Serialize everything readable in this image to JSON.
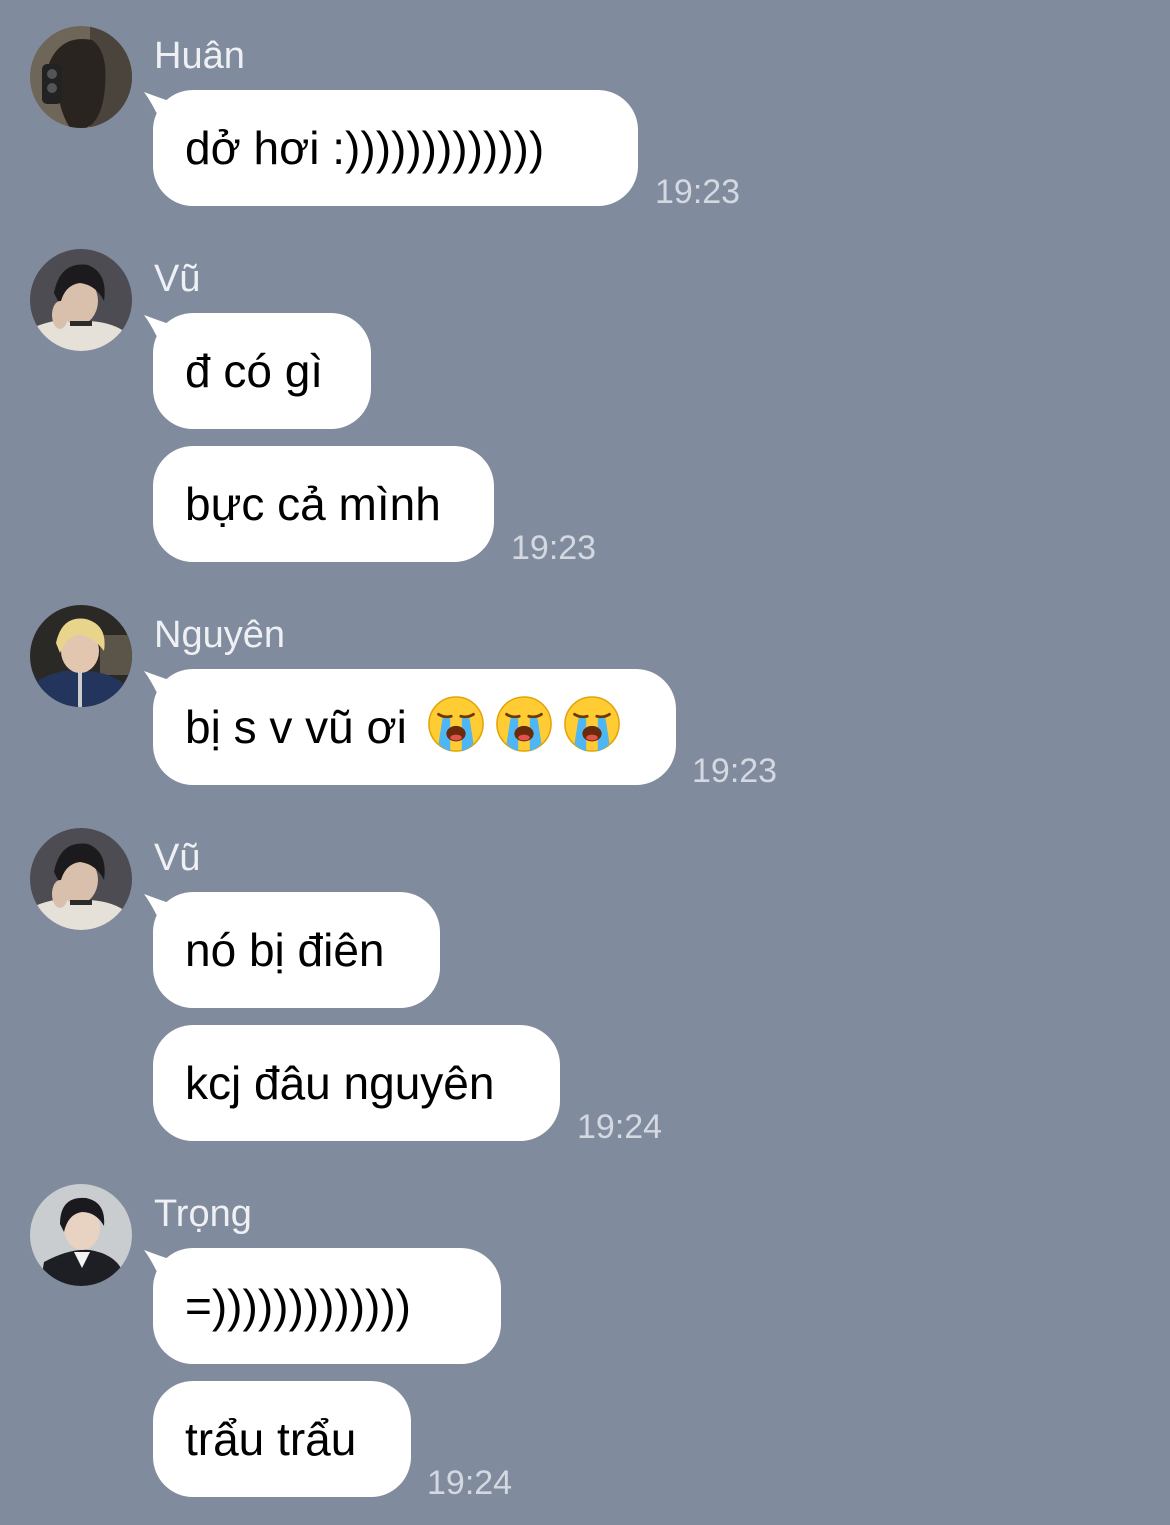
{
  "chat": {
    "groups": [
      {
        "sender": "Huân",
        "avatar": "avatar-huan",
        "messages": [
          {
            "text": "dở hơi :)))))))))))))",
            "emoji_count": 0
          }
        ],
        "time": "19:23"
      },
      {
        "sender": "Vũ",
        "avatar": "avatar-vu",
        "messages": [
          {
            "text": "đ có gì",
            "emoji_count": 0
          },
          {
            "text": "bực cả mình",
            "emoji_count": 0
          }
        ],
        "time": "19:23"
      },
      {
        "sender": "Nguyên",
        "avatar": "avatar-nguyen",
        "messages": [
          {
            "text": "bị s v vũ ơi",
            "emoji": "loudly-crying-face-icon",
            "emoji_count": 3
          }
        ],
        "time": "19:23"
      },
      {
        "sender": "Vũ",
        "avatar": "avatar-vu",
        "messages": [
          {
            "text": "nó bị điên",
            "emoji_count": 0
          },
          {
            "text": "kcj đâu nguyên",
            "emoji_count": 0
          }
        ],
        "time": "19:24"
      },
      {
        "sender": "Trọng",
        "avatar": "avatar-trong",
        "messages": [
          {
            "text": "=)))))))))))))",
            "emoji_count": 0
          },
          {
            "text": "trẩu trẩu",
            "emoji_count": 0
          }
        ],
        "time": "19:24"
      }
    ]
  },
  "colors": {
    "background": "#818b9e",
    "bubble": "#ffffff",
    "sender_text": "#eef0f4",
    "timestamp": "#d4d8e0"
  }
}
